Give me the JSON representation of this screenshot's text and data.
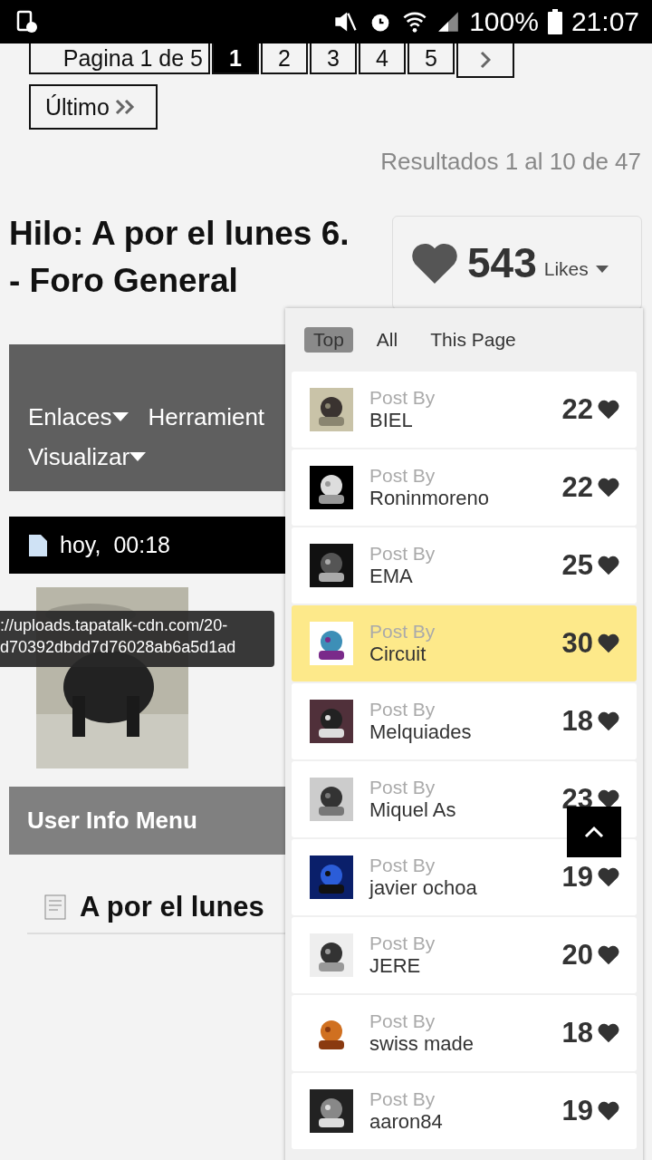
{
  "status_bar": {
    "battery": "100%",
    "time": "21:07"
  },
  "pagination": {
    "label": "Pagina 1 de 5",
    "pages": [
      {
        "label": "1",
        "selected": true
      },
      {
        "label": "2",
        "selected": false
      },
      {
        "label": "3",
        "selected": false
      },
      {
        "label": "4",
        "selected": false
      },
      {
        "label": "5",
        "selected": false
      }
    ],
    "last": "Último"
  },
  "results": "Resultados 1 al 10 de 47",
  "thread_title": "Hilo: A por el lunes 6. - Foro General",
  "menu": {
    "items": [
      "Enlaces",
      "Herramient",
      "Visualizar"
    ]
  },
  "post": {
    "date": "hoy,",
    "time": "00:18",
    "tooltip": [
      "://uploads.tapatalk-cdn.com/20-",
      "d70392dbdd7d76028ab6a5d1ad"
    ]
  },
  "user_info_menu": "User Info Menu",
  "post_title": "A por el lunes",
  "likes": {
    "count": "543",
    "label": "Likes",
    "tabs": [
      {
        "label": "Top",
        "selected": true
      },
      {
        "label": "All",
        "selected": false
      },
      {
        "label": "This Page",
        "selected": false
      }
    ],
    "rows": [
      {
        "caption": "Post By",
        "user": "BIEL",
        "count": "22",
        "selected": false
      },
      {
        "caption": "Post By",
        "user": "Roninmoreno",
        "count": "22",
        "selected": false
      },
      {
        "caption": "Post By",
        "user": "EMA",
        "count": "25",
        "selected": false
      },
      {
        "caption": "Post By",
        "user": "Circuit",
        "count": "30",
        "selected": true
      },
      {
        "caption": "Post By",
        "user": "Melquiades",
        "count": "18",
        "selected": false
      },
      {
        "caption": "Post By",
        "user": "Miquel As",
        "count": "23",
        "selected": false
      },
      {
        "caption": "Post By",
        "user": "javier ochoa",
        "count": "19",
        "selected": false
      },
      {
        "caption": "Post By",
        "user": "JERE",
        "count": "20",
        "selected": false
      },
      {
        "caption": "Post By",
        "user": "swiss made",
        "count": "18",
        "selected": false
      },
      {
        "caption": "Post By",
        "user": "aaron84",
        "count": "19",
        "selected": false
      }
    ]
  }
}
